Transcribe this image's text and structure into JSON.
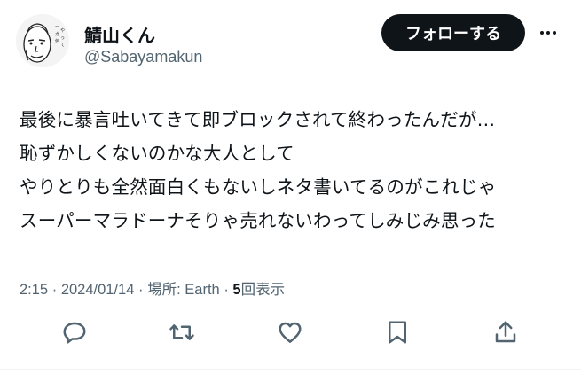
{
  "user": {
    "display_name": "鯖山くん",
    "handle": "@Sabayamakun",
    "avatar_icon": "caricature-face-avatar"
  },
  "header": {
    "follow_label": "フォローする",
    "more_icon": "more-horizontal-icon"
  },
  "tweet": {
    "lines": [
      "最後に暴言吐いてきて即ブロックされて終わったんだが…",
      "恥ずかしくないのかな大人として",
      "やりとりも全然面白くもないしネタ書いてるのがこれじゃ",
      "スーパーマラドーナそりゃ売れないわってしみじみ思った"
    ]
  },
  "meta": {
    "time": "2:15",
    "date": "2024/01/14",
    "location_label": "場所:",
    "location": "Earth",
    "views_count": "5",
    "views_label": "回表示",
    "separator": "·"
  },
  "actions": {
    "reply_icon": "reply-icon",
    "retweet_icon": "retweet-icon",
    "like_icon": "like-heart-icon",
    "bookmark_icon": "bookmark-icon",
    "share_icon": "share-icon"
  },
  "colors": {
    "text_primary": "#0f1419",
    "text_secondary": "#536471",
    "follow_button_bg": "#0f1419",
    "icon_color": "#536471"
  }
}
